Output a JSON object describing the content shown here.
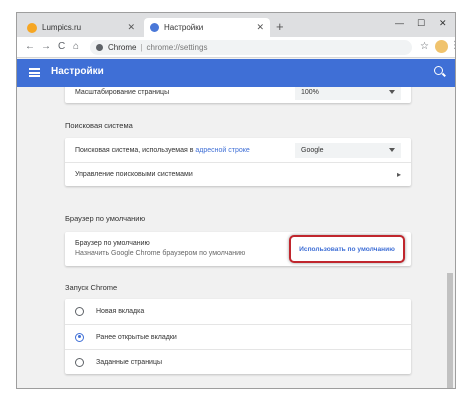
{
  "tabs": [
    {
      "title": "Lumpics.ru",
      "active": false
    },
    {
      "title": "Настройки",
      "active": true
    }
  ],
  "window_controls": {
    "minimize": "—",
    "maximize": "☐",
    "close": "✕"
  },
  "toolbar": {
    "back": "←",
    "forward": "→",
    "reload": "C",
    "home": "⌂",
    "origin": "Chrome",
    "url": "chrome://settings",
    "star": "☆",
    "menu": "⋮"
  },
  "header": {
    "title": "Настройки"
  },
  "page_zoom": {
    "label": "Масштабирование страницы",
    "value": "100%"
  },
  "search_engine": {
    "section_title": "Поисковая система",
    "label_prefix": "Поисковая система, используемая в ",
    "label_link": "адресной строке",
    "selected": "Google",
    "manage_label": "Управление поисковыми системами"
  },
  "default_browser": {
    "section_title": "Браузер по умолчанию",
    "title": "Браузер по умолчанию",
    "subtitle": "Назначить Google Chrome браузером по умолчанию",
    "button": "Использовать по умолчанию"
  },
  "startup": {
    "section_title": "Запуск Chrome",
    "options": [
      {
        "label": "Новая вкладка",
        "checked": false
      },
      {
        "label": "Ранее открытые вкладки",
        "checked": true
      },
      {
        "label": "Заданные страницы",
        "checked": false
      }
    ]
  },
  "colors": {
    "accent": "#3f6fd6",
    "highlight": "#c0262d"
  }
}
